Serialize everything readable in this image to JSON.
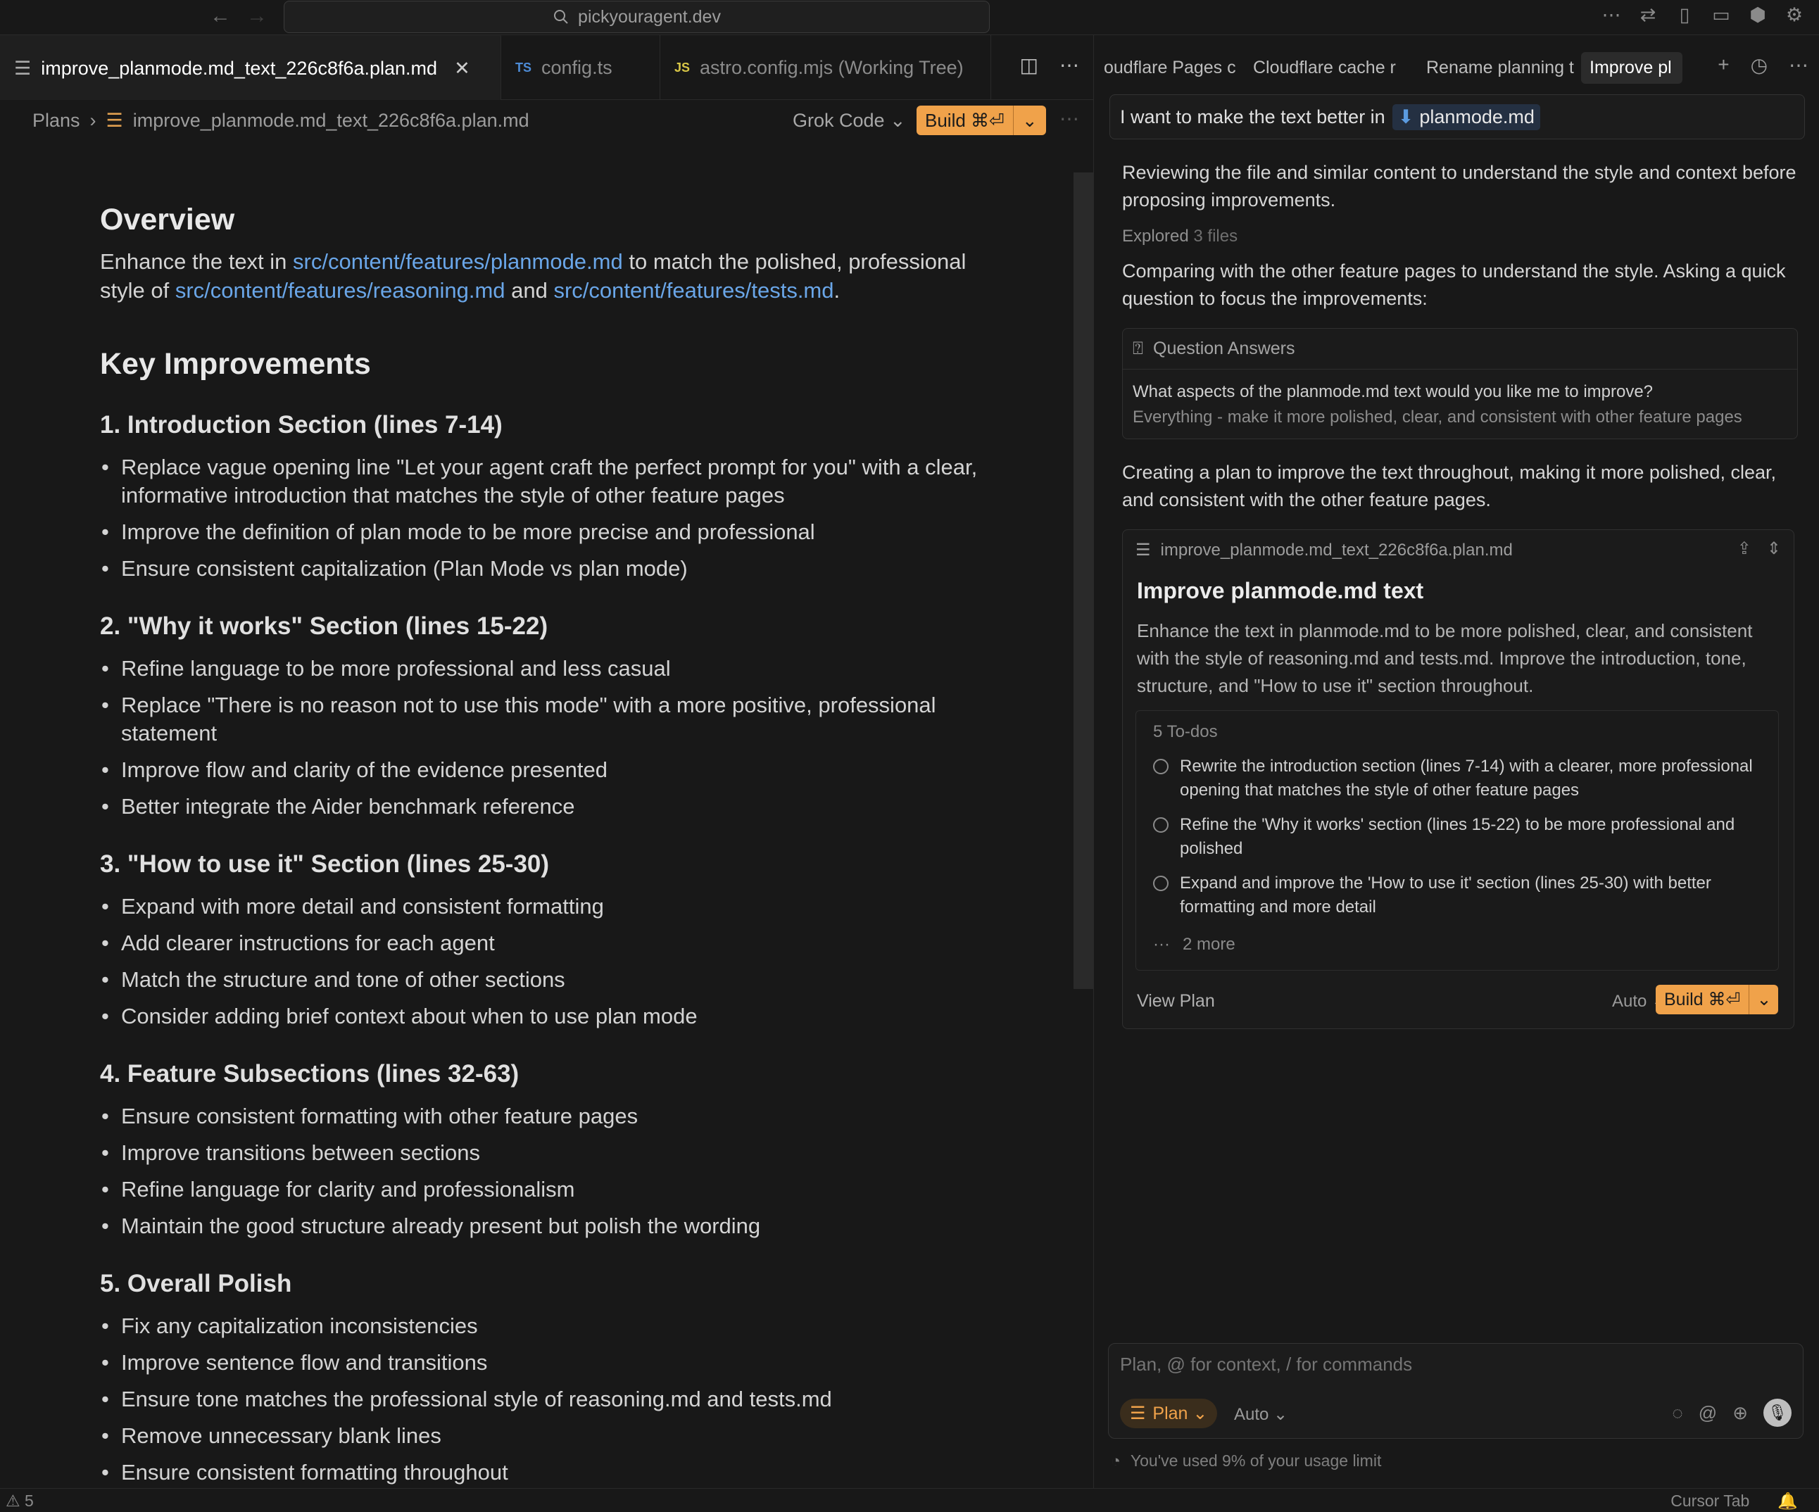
{
  "titlebar": {
    "back_icon": "←",
    "forward_icon": "→",
    "search_text": "pickyouragent.dev"
  },
  "editor": {
    "tabs": [
      {
        "label": "improve_planmode.md_text_226c8f6a.plan.md",
        "close": "✕"
      },
      {
        "badge": "TS",
        "label": "config.ts"
      },
      {
        "badge": "JS",
        "label": "astro.config.mjs (Working Tree)"
      }
    ],
    "breadcrumb": {
      "root": "Plans",
      "sep": "›",
      "file": "improve_planmode.md_text_226c8f6a.plan.md"
    },
    "model": "Grok Code ⌄",
    "build_label": "Build ⌘⏎",
    "build_dropdown": "⌄"
  },
  "doc": {
    "overview_title": "Overview",
    "overview": {
      "t1": "Enhance the text in ",
      "link1": "src/content/features/planmode.md",
      "t2": " to match the polished, professional style of ",
      "link2": "src/content/features/reasoning.md",
      "t3": " and ",
      "link3": "src/content/features/tests.md",
      "t4": "."
    },
    "key_title": "Key Improvements",
    "sections": [
      {
        "title": "1. Introduction Section (lines 7-14)",
        "items": [
          "Replace vague opening line \"Let your agent craft the perfect prompt for you\" with a clear, informative introduction that matches the style of other feature pages",
          "Improve the definition of plan mode to be more precise and professional",
          "Ensure consistent capitalization (Plan Mode vs plan mode)"
        ]
      },
      {
        "title": "2. \"Why it works\" Section (lines 15-22)",
        "items": [
          "Refine language to be more professional and less casual",
          "Replace \"There is no reason not to use this mode\" with a more positive, professional statement",
          "Improve flow and clarity of the evidence presented",
          "Better integrate the Aider benchmark reference"
        ]
      },
      {
        "title": "3. \"How to use it\" Section (lines 25-30)",
        "items": [
          "Expand with more detail and consistent formatting",
          "Add clearer instructions for each agent",
          "Match the structure and tone of other sections",
          "Consider adding brief context about when to use plan mode"
        ]
      },
      {
        "title": "4. Feature Subsections (lines 32-63)",
        "items": [
          "Ensure consistent formatting with other feature pages",
          "Improve transitions between sections",
          "Refine language for clarity and professionalism",
          "Maintain the good structure already present but polish the wording"
        ]
      },
      {
        "title": "5. Overall Polish",
        "items": [
          "Fix any capitalization inconsistencies",
          "Improve sentence flow and transitions",
          "Ensure tone matches the professional style of reasoning.md and tests.md",
          "Remove unnecessary blank lines",
          "Ensure consistent formatting throughout"
        ]
      }
    ]
  },
  "chat": {
    "tabs": [
      "oudflare Pages c",
      "Cloudflare cache r",
      "Rename planning t",
      "Improve pl"
    ],
    "prompt": {
      "text": "I want to make the text better in",
      "chip_icon": "⬇",
      "chip": "planmode.md"
    },
    "msg1": "Reviewing the file and similar content to understand the style and context before proposing improvements.",
    "explored_label": "Explored",
    "explored_count": "3 files",
    "msg2": "Comparing with the other feature pages to understand the style. Asking a quick question to focus the improvements:",
    "qa": {
      "header": "Question Answers",
      "question": "What aspects of the planmode.md text would you like me to improve?",
      "answer": "Everything - make it more polished, clear, and consistent with other feature pages"
    },
    "msg3": "Creating a plan to improve the text throughout, making it more polished, clear, and consistent with the other feature pages.",
    "plan": {
      "file": "improve_planmode.md_text_226c8f6a.plan.md",
      "title": "Improve planmode.md text",
      "description": "Enhance the text in planmode.md to be more polished, clear, and consistent with the style of reasoning.md and tests.md. Improve the introduction, tone, structure, and \"How to use it\" section throughout.",
      "todos_header": "5 To-dos",
      "todos": [
        "Rewrite the introduction section (lines 7-14) with a clearer, more professional opening that matches the style of other feature pages",
        "Refine the 'Why it works' section (lines 15-22) to be more professional and polished",
        "Expand and improve the 'How to use it' section (lines 25-30) with better formatting and more detail"
      ],
      "more_dots": "···",
      "more": "2 more",
      "view_plan": "View Plan",
      "auto": "Auto ⌄",
      "build_label": "Build ⌘⏎",
      "build_dropdown": "⌄"
    },
    "composer": {
      "placeholder": "Plan, @ for context, / for commands",
      "mode": "Plan ⌄",
      "auto": "Auto ⌄"
    },
    "usage": "You've used 9% of your usage limit"
  },
  "statusbar": {
    "problems": "⚠ 5",
    "cursor_tab": "Cursor Tab"
  }
}
